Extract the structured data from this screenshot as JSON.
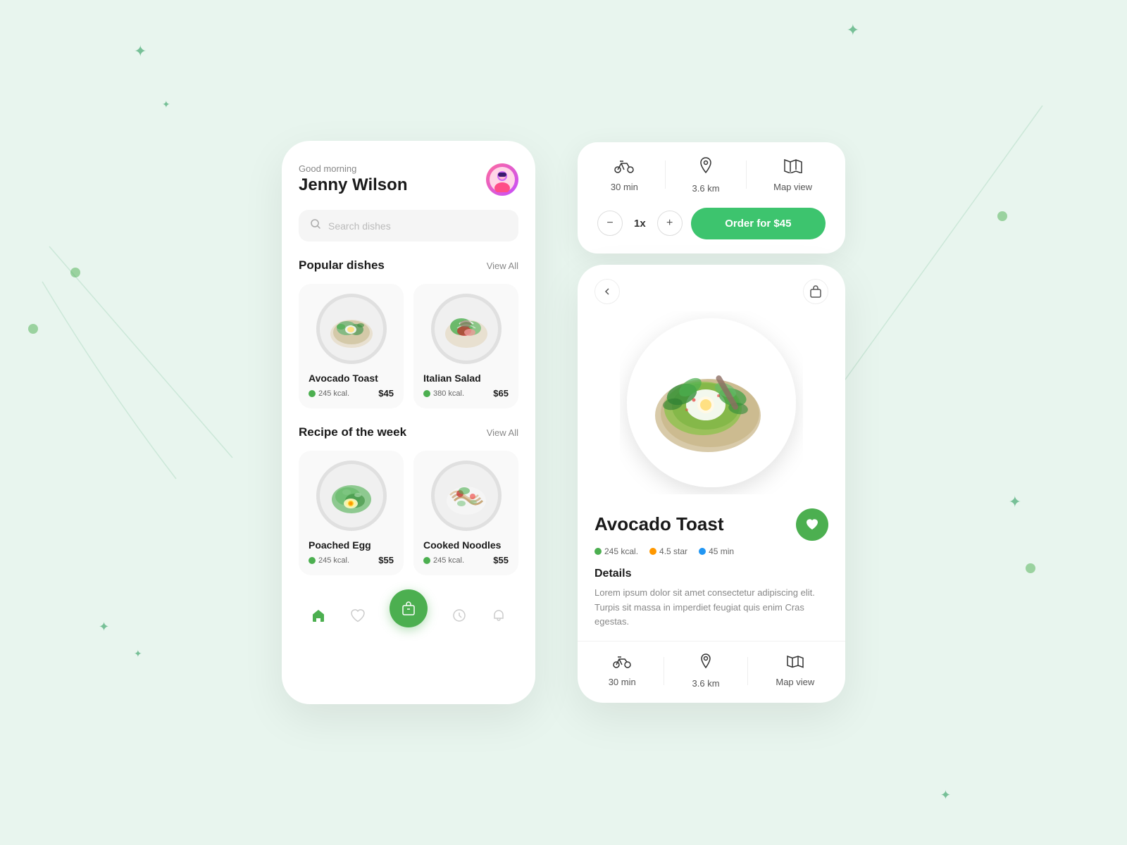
{
  "background": "#e8f5ee",
  "accent": "#4caf50",
  "left_panel": {
    "greeting": "Good morning",
    "user_name": "Jenny Wilson",
    "search_placeholder": "Search dishes",
    "popular_section": {
      "title": "Popular dishes",
      "view_all": "View All",
      "dishes": [
        {
          "name": "Avocado Toast",
          "kcal": "245 kcal.",
          "price": "$45",
          "emoji": "🥗"
        },
        {
          "name": "Italian Salad",
          "kcal": "380 kcal.",
          "price": "$65",
          "emoji": "🥙"
        }
      ]
    },
    "recipe_section": {
      "title": "Recipe of the week",
      "view_all": "View All",
      "dishes": [
        {
          "name": "Poached Egg",
          "kcal": "245 kcal.",
          "price": "$55",
          "emoji": "🍳"
        },
        {
          "name": "Cooked Noodles",
          "kcal": "245 kcal.",
          "price": "$55",
          "emoji": "🍜"
        }
      ]
    },
    "nav": {
      "home_label": "home",
      "heart_label": "favorites",
      "cart_label": "cart",
      "history_label": "history",
      "bell_label": "notifications"
    }
  },
  "right_panel": {
    "top_card": {
      "metrics": [
        {
          "icon": "🚲",
          "label": "30 min"
        },
        {
          "icon": "📍",
          "label": "3.6 km"
        },
        {
          "icon": "🗺️",
          "label": "Map view"
        }
      ],
      "quantity": "1x",
      "order_btn": "Order for $45"
    },
    "detail_card": {
      "dish_name": "Avocado Toast",
      "kcal": "245 kcal.",
      "rating": "4.5 star",
      "time": "45 min",
      "details_title": "Details",
      "description": "Lorem ipsum dolor sit amet consectetur adipiscing elit. Turpis sit massa in imperdiet feugiat quis enim Cras egestas.",
      "bottom_metrics": [
        {
          "icon": "🚲",
          "label": "30 min"
        },
        {
          "icon": "📍",
          "label": "3.6 km"
        },
        {
          "icon": "🗺️",
          "label": "Map view"
        }
      ]
    }
  }
}
